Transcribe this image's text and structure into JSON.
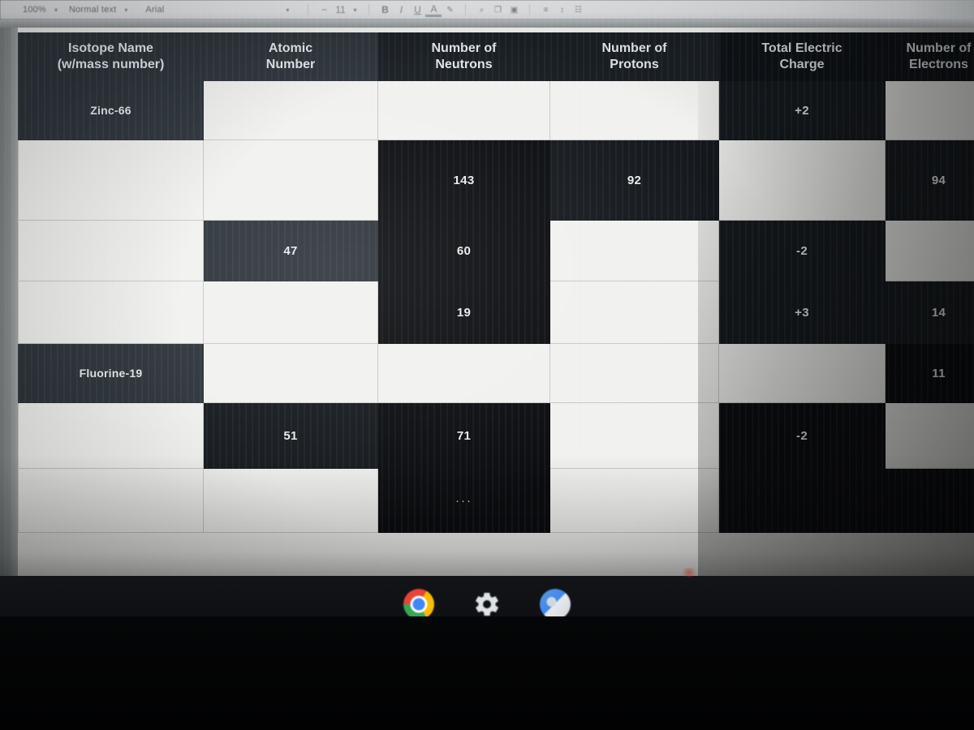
{
  "app": {
    "name": "google-docs",
    "zoom": "100%",
    "paragraph_style": "Normal text",
    "font": "Arial"
  },
  "toolbar": {
    "zoom_label": "100%",
    "style_label": "Normal text",
    "font_label": "Arial",
    "font_size": "11",
    "caret": "▾",
    "decrease_font": "−",
    "bold": "B",
    "italic": "I",
    "underline": "U",
    "text_color": "A",
    "highlight": "✎",
    "link": "⌕",
    "comment": "❐",
    "image": "▣",
    "align": "≡",
    "line_spacing": "↕",
    "list": "☷"
  },
  "table": {
    "columns": [
      "Isotope Name (w/mass number)",
      "Atomic Number",
      "Number of Neutrons",
      "Number of Protons",
      "Total Electric Charge",
      "Number of Electrons"
    ],
    "column_lines": [
      [
        "Isotope Name",
        "(w/mass number)"
      ],
      [
        "Atomic",
        "Number"
      ],
      [
        "Number of",
        "Neutrons"
      ],
      [
        "Number of",
        "Protons"
      ],
      [
        "Total Electric",
        "Charge"
      ],
      [
        "Number of",
        "Electrons"
      ]
    ],
    "rows": [
      {
        "isotope_name": "Zinc-66",
        "atomic_number": "",
        "neutrons": "",
        "protons": "",
        "charge": "+2",
        "electrons": ""
      },
      {
        "isotope_name": "",
        "atomic_number": "",
        "neutrons": "143",
        "protons": "92",
        "charge": "",
        "electrons": "94"
      },
      {
        "isotope_name": "",
        "atomic_number": "47",
        "neutrons": "60",
        "protons": "",
        "charge": "-2",
        "electrons": ""
      },
      {
        "isotope_name": "",
        "atomic_number": "",
        "neutrons": "19",
        "protons": "",
        "charge": "+3",
        "electrons": "14"
      },
      {
        "isotope_name": "Fluorine-19",
        "atomic_number": "",
        "neutrons": "",
        "protons": "",
        "charge": "",
        "electrons": "11"
      },
      {
        "isotope_name": "",
        "atomic_number": "51",
        "neutrons": "71",
        "protons": "",
        "charge": "-2",
        "electrons": ""
      },
      {
        "isotope_name": "",
        "atomic_number": "",
        "neutrons": "···",
        "protons": "",
        "charge": "",
        "electrons": ""
      }
    ]
  },
  "shelf": {
    "icons": [
      {
        "name": "chrome-icon",
        "label": "Chrome"
      },
      {
        "name": "settings-gear-icon",
        "label": "Settings"
      },
      {
        "name": "files-app-icon",
        "label": "Files"
      }
    ]
  },
  "colors": {
    "shaded_cell": "#2b3238",
    "cell_text": "#e9ebec",
    "page_background": "#f1f1ef",
    "toolbar_background": "#e4e6e8",
    "shelf_background": "#0b0d10"
  }
}
